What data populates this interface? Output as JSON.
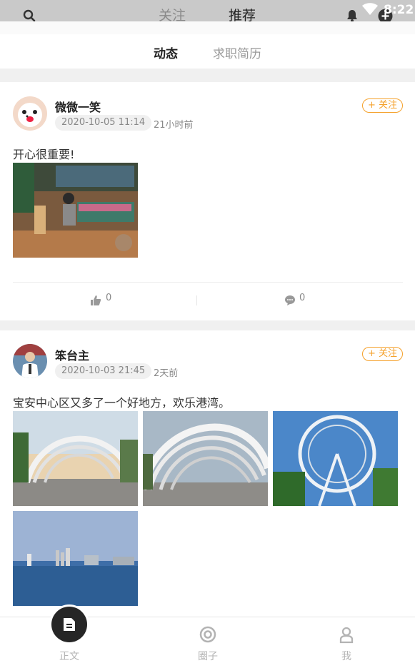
{
  "status_bar": {
    "time": "8:22"
  },
  "top_tabs": [
    {
      "label": "关注",
      "active": false
    },
    {
      "label": "推荐",
      "active": true
    }
  ],
  "sub_tabs": [
    {
      "label": "动态",
      "active": true
    },
    {
      "label": "求职简历",
      "active": false
    }
  ],
  "posts": [
    {
      "username": "微微一笑",
      "datetime": "2020-10-05 11:14",
      "ago": "21小时前",
      "follow_label": "+ 关注",
      "text": "开心很重要!",
      "image_count": 1,
      "likes": "0",
      "comments": "0"
    },
    {
      "username": "笨台主",
      "datetime": "2020-10-03 21:45",
      "ago": "2天前",
      "follow_label": "+ 关注",
      "text": "宝安中心区又多了一个好地方，欢乐港湾。",
      "image_count": 4
    }
  ],
  "bottom_nav": [
    {
      "label": "正文",
      "icon": "document-icon",
      "active": true
    },
    {
      "label": "圈子",
      "icon": "circle-icon",
      "active": false
    },
    {
      "label": "我",
      "icon": "person-icon",
      "active": false
    }
  ],
  "colors": {
    "accent": "#f5a12b",
    "fab": "#262626"
  }
}
